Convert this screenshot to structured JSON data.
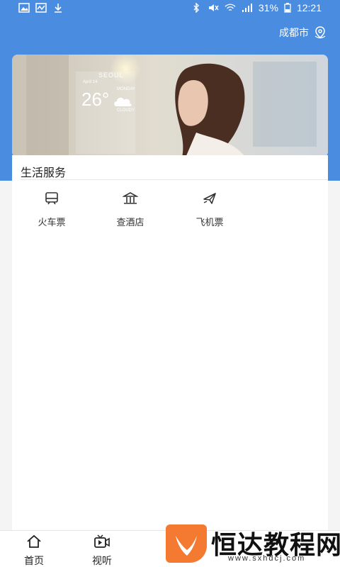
{
  "status_bar": {
    "battery": "31%",
    "time": "12:21"
  },
  "header": {
    "location": "成都市"
  },
  "banner": {
    "weather_city": "SEOUL",
    "weather_temp": "26°",
    "weather_condition": "CLOUDY",
    "weather_date": "April 14",
    "weather_day": "MONDAY"
  },
  "services": {
    "title": "生活服务",
    "items": [
      {
        "label": "火车票",
        "icon": "train-icon"
      },
      {
        "label": "查酒店",
        "icon": "hotel-icon"
      },
      {
        "label": "飞机票",
        "icon": "plane-icon"
      }
    ]
  },
  "tabbar": {
    "items": [
      {
        "label": "首页",
        "icon": "home-icon"
      },
      {
        "label": "视听",
        "icon": "video-icon"
      }
    ]
  },
  "watermark": {
    "text": "恒达教程网",
    "url": "www.sxhdcj.com",
    "color": "#f37a30"
  }
}
